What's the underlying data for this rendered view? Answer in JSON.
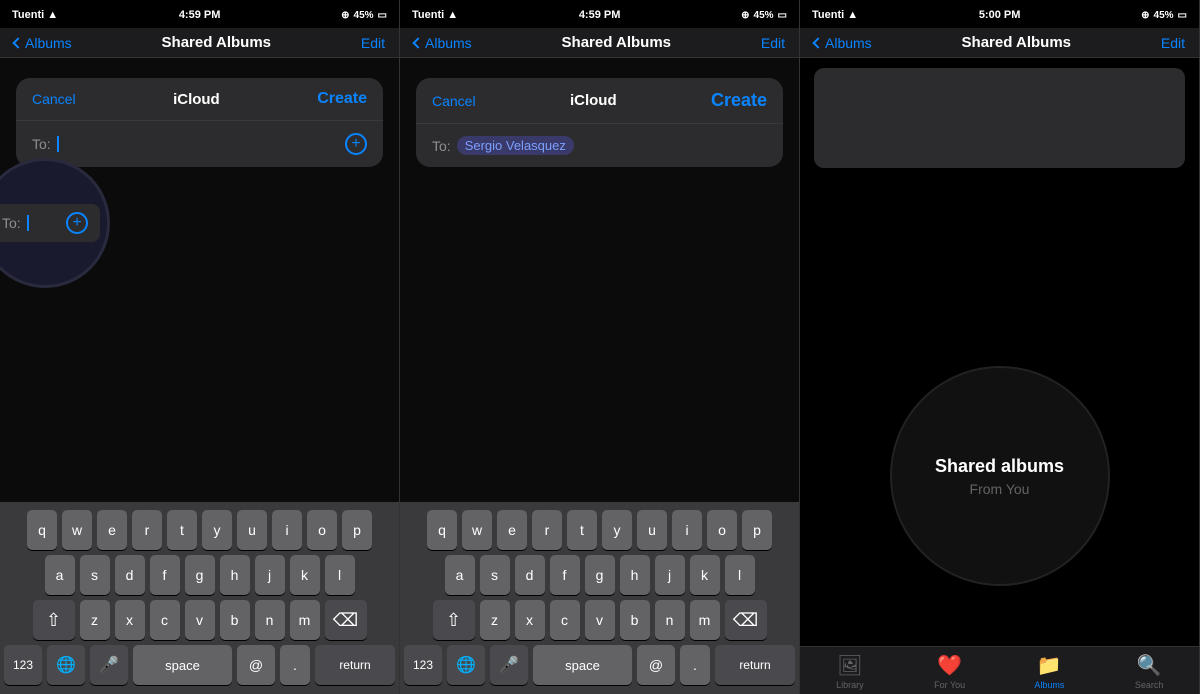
{
  "panels": [
    {
      "id": "panel1",
      "statusBar": {
        "carrier": "Tuenti",
        "time": "4:59 PM",
        "battery": "45%"
      },
      "navBar": {
        "back": "Albums",
        "title": "Shared Albums",
        "action": "Edit"
      },
      "modal": {
        "cancel": "Cancel",
        "title": "iCloud",
        "create": "Create",
        "toLabel": "To:",
        "toValue": ""
      },
      "keyboard": {
        "rows": [
          [
            "q",
            "w",
            "e",
            "r",
            "t",
            "y",
            "u",
            "i",
            "o",
            "p"
          ],
          [
            "a",
            "s",
            "d",
            "f",
            "g",
            "h",
            "j",
            "k",
            "l"
          ],
          [
            "z",
            "x",
            "c",
            "v",
            "b",
            "n",
            "m"
          ],
          [
            "123",
            "🌐",
            "🎤",
            "space",
            "@",
            ".",
            "return"
          ]
        ]
      }
    },
    {
      "id": "panel2",
      "statusBar": {
        "carrier": "Tuenti",
        "time": "4:59 PM",
        "battery": "45%"
      },
      "navBar": {
        "back": "Albums",
        "title": "Shared Albums",
        "action": "Edit"
      },
      "modal": {
        "cancel": "Cancel",
        "title": "iCloud",
        "create": "Create",
        "toLabel": "To:",
        "toValue": "Sergio Velasquez"
      },
      "keyboard": {
        "rows": [
          [
            "q",
            "w",
            "e",
            "r",
            "t",
            "y",
            "u",
            "i",
            "o",
            "p"
          ],
          [
            "a",
            "s",
            "d",
            "f",
            "g",
            "h",
            "j",
            "k",
            "l"
          ],
          [
            "z",
            "x",
            "c",
            "v",
            "b",
            "n",
            "m"
          ],
          [
            "123",
            "🌐",
            "🎤",
            "space",
            "@",
            ".",
            "return"
          ]
        ]
      }
    },
    {
      "id": "panel3",
      "statusBar": {
        "carrier": "Tuenti",
        "time": "5:00 PM",
        "battery": "45%"
      },
      "navBar": {
        "back": "Albums",
        "title": "Shared Albums",
        "action": "Edit"
      },
      "sharedAlbums": {
        "title": "Shared albums",
        "subtitle": "From You"
      },
      "tabBar": {
        "items": [
          {
            "icon": "🖼",
            "label": "Library",
            "active": false
          },
          {
            "icon": "❤",
            "label": "For You",
            "active": false
          },
          {
            "icon": "📁",
            "label": "Albums",
            "active": true
          },
          {
            "icon": "🔍",
            "label": "Search",
            "active": false
          }
        ]
      }
    }
  ]
}
